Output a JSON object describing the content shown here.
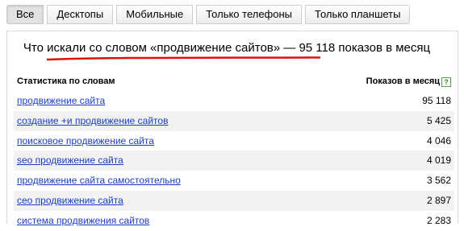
{
  "tabs": [
    {
      "label": "Все",
      "active": true
    },
    {
      "label": "Десктопы",
      "active": false
    },
    {
      "label": "Мобильные",
      "active": false
    },
    {
      "label": "Только телефоны",
      "active": false
    },
    {
      "label": "Только планшеты",
      "active": false
    }
  ],
  "heading": {
    "link_text": "Что искали со словом «продвижение сайтов»",
    "separator": " — ",
    "count": "95 118",
    "suffix": " показов в месяц"
  },
  "table": {
    "col_phrase": "Статистика по словам",
    "col_count": "Показов в месяц",
    "help": "?",
    "rows": [
      {
        "phrase": "продвижение сайта",
        "count": "95 118"
      },
      {
        "phrase": "создание +и продвижение сайтов",
        "count": "5 425"
      },
      {
        "phrase": "поисковое продвижение сайта",
        "count": "4 046"
      },
      {
        "phrase": "seo продвижение сайта",
        "count": "4 019"
      },
      {
        "phrase": "продвижение сайта самостоятельно",
        "count": "3 562"
      },
      {
        "phrase": "сео продвижение сайта",
        "count": "2 897"
      },
      {
        "phrase": "система продвижения сайтов",
        "count": "2 283"
      }
    ]
  },
  "colors": {
    "link": "#1a3dc1",
    "underline": "#e01010",
    "help": "#3f8a2e"
  }
}
